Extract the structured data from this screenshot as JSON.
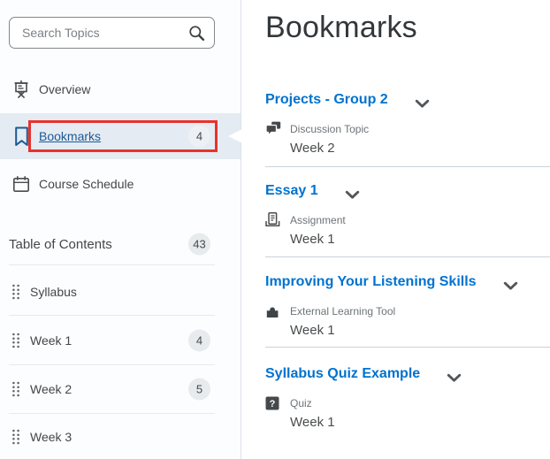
{
  "sidebar": {
    "search": {
      "placeholder": "Search Topics",
      "icon": "search-icon"
    },
    "nav": [
      {
        "label": "Overview",
        "icon": "presentation-icon"
      },
      {
        "label": "Bookmarks",
        "icon": "bookmark-icon",
        "badge": "4",
        "selected": true,
        "annotated": true
      },
      {
        "label": "Course Schedule",
        "icon": "calendar-icon"
      }
    ],
    "table_of_contents": {
      "label": "Table of Contents",
      "badge": "43"
    },
    "toc_items": [
      {
        "label": "Syllabus",
        "icon": "drag-handle-icon"
      },
      {
        "label": "Week 1",
        "icon": "drag-handle-icon",
        "badge": "4"
      },
      {
        "label": "Week 2",
        "icon": "drag-handle-icon",
        "badge": "5"
      },
      {
        "label": "Week 3",
        "icon": "drag-handle-icon"
      }
    ]
  },
  "main": {
    "title": "Bookmarks",
    "items": [
      {
        "title": "Projects - Group 2",
        "type": "Discussion Topic",
        "icon": "discussion-icon",
        "location": "Week 2"
      },
      {
        "title": "Essay 1",
        "type": "Assignment",
        "icon": "assignment-icon",
        "location": "Week 1"
      },
      {
        "title": "Improving Your Listening Skills",
        "type": "External Learning Tool",
        "icon": "external-tool-icon",
        "location": "Week 1"
      },
      {
        "title": "Syllabus Quiz Example",
        "type": "Quiz",
        "icon": "quiz-icon",
        "location": "Week 1"
      }
    ]
  },
  "annotations": {
    "highlight_box_color": "#e8322b"
  },
  "colors": {
    "content_link_blue": "#0072cf",
    "sidebar_link_blue": "#1a5a96",
    "selected_row_bg": "#e5ebf2",
    "badge_bg": "#e8ebee",
    "divider": "#c9d3db"
  }
}
